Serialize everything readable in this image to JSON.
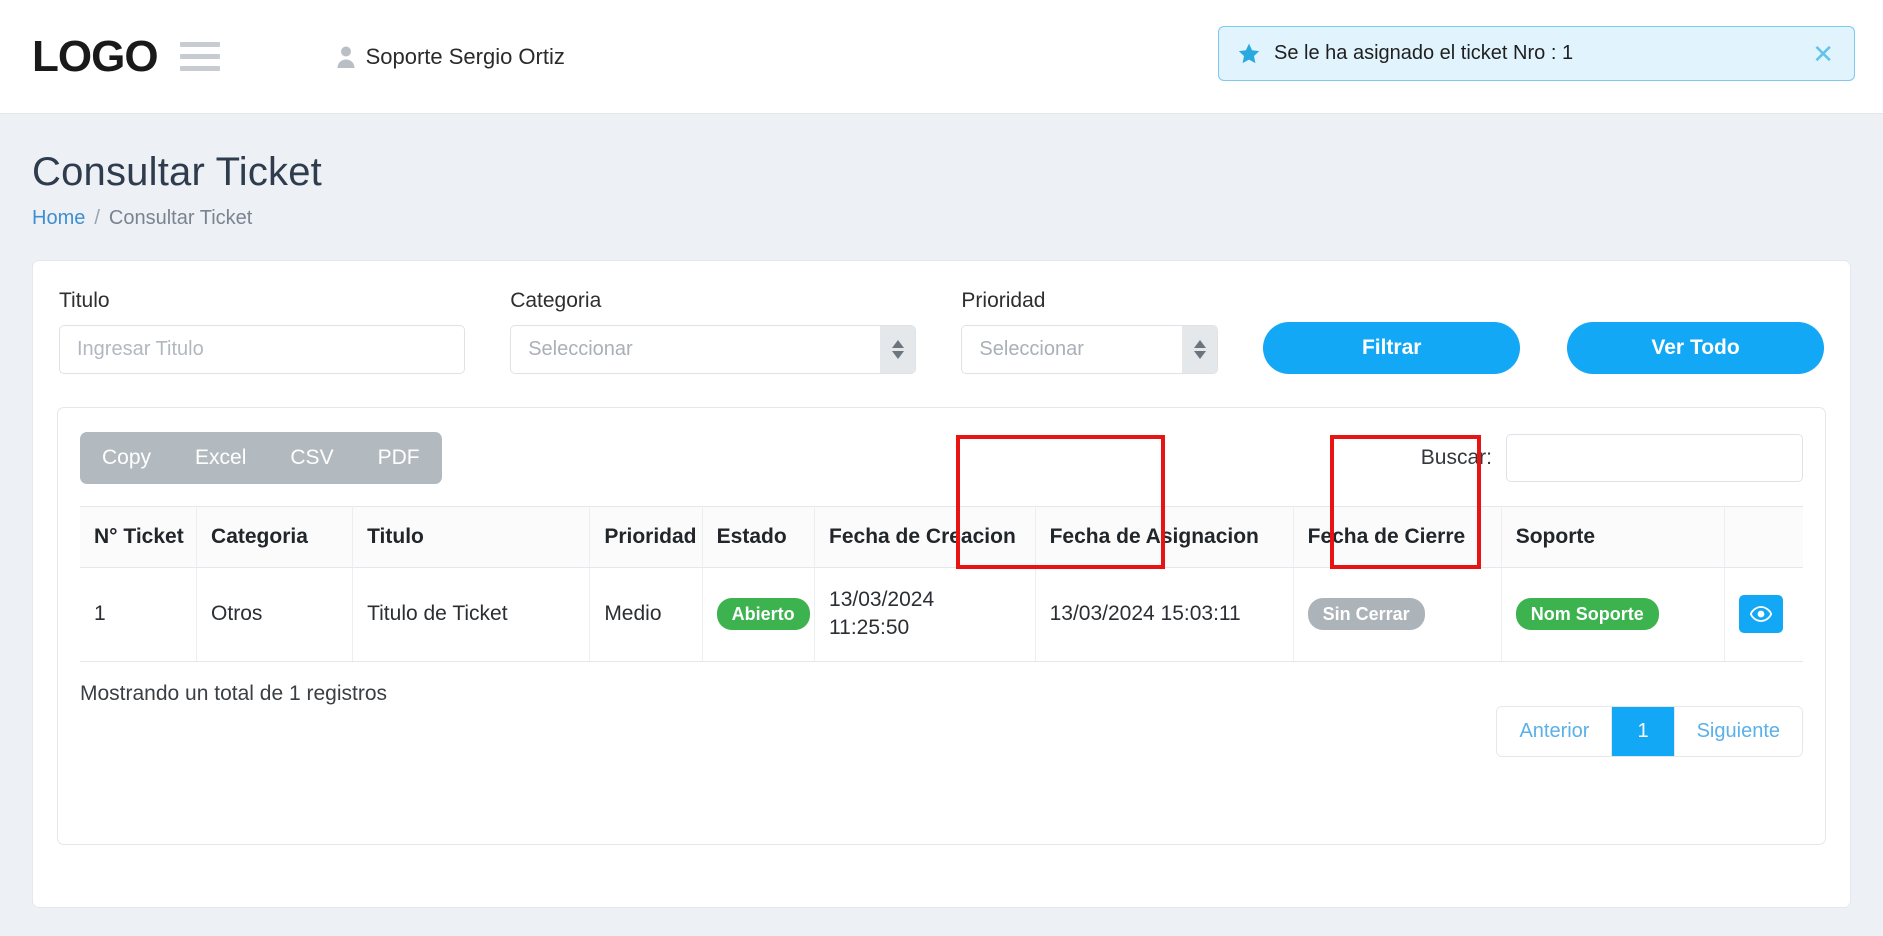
{
  "navbar": {
    "logo": "LOGO",
    "user_name": "Soporte Sergio Ortiz",
    "menu_icon": "hamburger-icon",
    "user_icon": "user-avatar-icon"
  },
  "alert": {
    "icon": "star-icon",
    "message": "Se le ha asignado el ticket Nro : 1",
    "close_label": "✕",
    "bg_color": "#e1f4fd",
    "border_color": "#7cc9ee",
    "accent_color": "#2aa8e0"
  },
  "page": {
    "title": "Consultar Ticket",
    "breadcrumb": {
      "home": "Home",
      "separator": "/",
      "current": "Consultar Ticket"
    }
  },
  "filters": {
    "titulo": {
      "label": "Titulo",
      "value": "",
      "placeholder": "Ingresar Titulo"
    },
    "categoria": {
      "label": "Categoria",
      "value": "Seleccionar"
    },
    "prioridad": {
      "label": "Prioridad",
      "value": "Seleccionar"
    },
    "filtrar_button": "Filtrar",
    "vertodo_button": "Ver Todo",
    "accent_color": "#12a8f5"
  },
  "table_toolbar": {
    "export_buttons": [
      "Copy",
      "Excel",
      "CSV",
      "PDF"
    ],
    "search_label": "Buscar:",
    "search_value": "",
    "export_bg": "#b3babf"
  },
  "table": {
    "headers": [
      "N° Ticket",
      "Categoria",
      "Titulo",
      "Prioridad",
      "Estado",
      "Fecha de Creacion",
      "Fecha de Asignacion",
      "Fecha de Cierre",
      "Soporte",
      ""
    ],
    "rows": [
      {
        "num": "1",
        "categoria": "Otros",
        "titulo": "Titulo de Ticket",
        "prioridad": "Medio",
        "estado": "Abierto",
        "estado_color": "#3cb34e",
        "fecha_creacion_line1": "13/03/2024",
        "fecha_creacion_line2": "11:25:50",
        "fecha_asignacion": "13/03/2024 15:03:11",
        "fecha_cierre": "Sin Cerrar",
        "fecha_cierre_color": "#acb3b9",
        "soporte": "Nom Soporte",
        "soporte_color": "#3cb34e",
        "action_icon": "eye-icon"
      }
    ]
  },
  "annotations": [
    {
      "name": "fecha-asignacion-highlight",
      "color": "#e81414"
    },
    {
      "name": "soporte-highlight",
      "color": "#e81414"
    }
  ],
  "footer": {
    "record_count": "Mostrando un total de 1 registros",
    "pagination": {
      "previous": "Anterior",
      "pages": [
        "1"
      ],
      "next": "Siguiente",
      "active_page": "1",
      "active_color": "#12a8f5"
    }
  }
}
